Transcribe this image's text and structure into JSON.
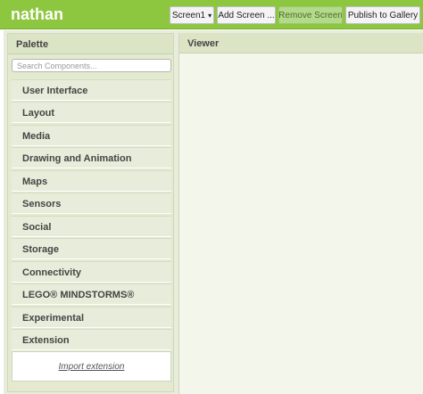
{
  "header": {
    "project_name": "nathan",
    "screen_select": {
      "label": "Screen1",
      "caret": "▾"
    },
    "add_screen_label": "Add Screen ...",
    "remove_screen_label": "Remove Screen",
    "publish_label": "Publish to Gallery"
  },
  "palette": {
    "title": "Palette",
    "search_placeholder": "Search Components...",
    "categories": [
      "User Interface",
      "Layout",
      "Media",
      "Drawing and Animation",
      "Maps",
      "Sensors",
      "Social",
      "Storage",
      "Connectivity",
      "LEGO® MINDSTORMS®",
      "Experimental",
      "Extension"
    ],
    "import_extension_label": "Import extension"
  },
  "viewer": {
    "title": "Viewer"
  },
  "colors": {
    "toolbar_green": "#8dc63f",
    "panel_bg": "#e3ead0",
    "viewer_bg": "#f3f6ea"
  }
}
